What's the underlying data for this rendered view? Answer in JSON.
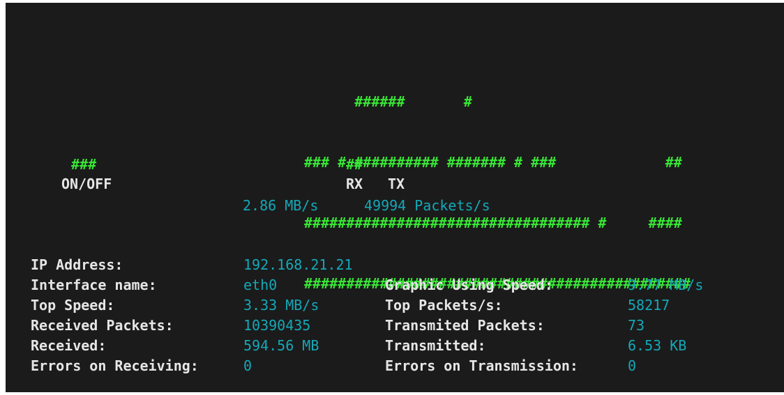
{
  "graph": {
    "rows": [
      "      ######       #",
      "### # ########## ####### # ###             ##",
      "################################## #     ####",
      "##############################################"
    ]
  },
  "indicators": {
    "onoff_marks": "###",
    "onoff_label": "ON/OFF",
    "rxtx_marks": "##",
    "rx_label": "RX",
    "tx_label": "TX"
  },
  "rates": {
    "speed": "2.86 MB/s",
    "packets": "49994 Packets/s"
  },
  "stats": {
    "ip_label": "IP Address:",
    "ip_value": "192.168.21.21",
    "iface_label": "Interface name:",
    "iface_value": "eth0",
    "graphic_speed_label": "Graphic Using Speed:",
    "graphic_speed_value": "9.77 MB/s",
    "top_speed_label": "Top Speed:",
    "top_speed_value": "3.33 MB/s",
    "top_packets_label": "Top Packets/s:",
    "top_packets_value": "58217",
    "rx_packets_label": "Received Packets:",
    "rx_packets_value": "10390435",
    "tx_packets_label": "Transmited Packets:",
    "tx_packets_value": "73",
    "received_label": "Received:",
    "received_value": "594.56 MB",
    "transmitted_label": "Transmitted:",
    "transmitted_value": "6.53 KB",
    "rx_errors_label": "Errors on Receiving:",
    "rx_errors_value": "0",
    "tx_errors_label": "Errors on Transmission:",
    "tx_errors_value": "0"
  }
}
